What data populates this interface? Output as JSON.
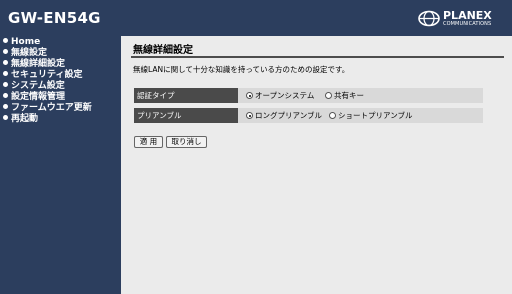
{
  "header": {
    "model": "GW-EN54G",
    "logo_brand": "PLANEX",
    "logo_sub": "COMMUNICATIONS"
  },
  "sidebar": {
    "items": [
      {
        "label": "Home"
      },
      {
        "label": "無線設定"
      },
      {
        "label": "無線詳細設定"
      },
      {
        "label": "セキュリティ設定"
      },
      {
        "label": "システム設定"
      },
      {
        "label": "設定情報管理"
      },
      {
        "label": "ファームウエア更新"
      },
      {
        "label": "再起動"
      }
    ]
  },
  "main": {
    "title": "無線詳細設定",
    "description": "無線LANに関して十分な知識を持っている方のための設定です。",
    "settings": [
      {
        "label": "認証タイプ",
        "options": [
          {
            "label": "オープンシステム",
            "selected": true
          },
          {
            "label": "共有キー",
            "selected": false
          }
        ]
      },
      {
        "label": "プリアンブル",
        "options": [
          {
            "label": "ロングプリアンブル",
            "selected": true
          },
          {
            "label": "ショートプリアンブル",
            "selected": false
          }
        ]
      }
    ],
    "apply_label": "適 用",
    "cancel_label": "取り消し"
  }
}
